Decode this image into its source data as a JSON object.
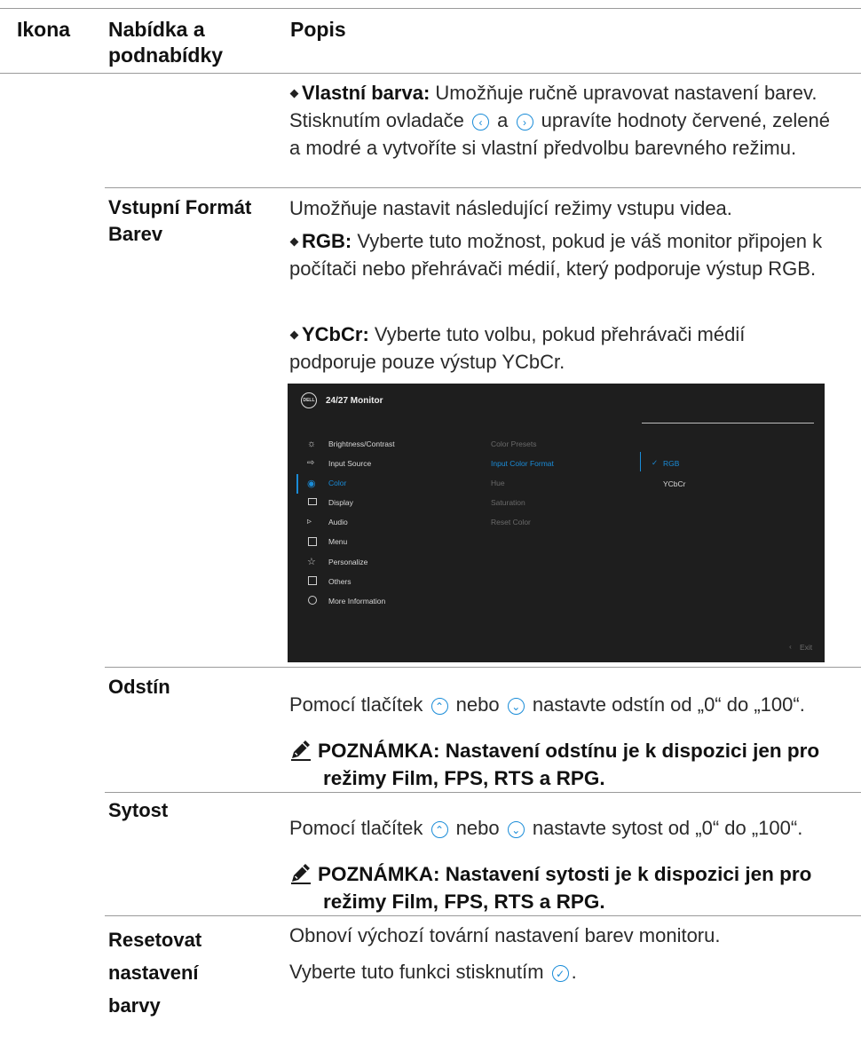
{
  "table": {
    "headers": {
      "icon": "Ikona",
      "menu": "Nabídka a podnabídky",
      "desc": "Popis"
    },
    "custom_color": {
      "bullet_label": "Vlastní barva:",
      "text_1": "Umožňuje ručně upravovat nastavení barev. Stisknutím ovladače",
      "text_2": "a",
      "text_3": "upravíte hodnoty červené, zelené a modré a vytvoříte si vlastní předvolbu barevného režimu."
    },
    "input_color_format": {
      "label": "Vstupní Formát Barev",
      "intro": "Umožňuje nastavit následující režimy vstupu videa.",
      "rgb_label": "RGB:",
      "rgb_text": "Vyberte tuto možnost, pokud je váš monitor připojen k počítači nebo přehrávači médií, který podporuje výstup RGB.",
      "ycbcr_label": "YCbCr:",
      "ycbcr_text": "Vyberte tuto volbu, pokud přehrávači médií podporuje pouze výstup YCbCr."
    },
    "hue": {
      "label": "Odstín",
      "text_1": "Pomocí tlačítek",
      "text_2": "nebo",
      "text_3": "nastavte odstín od „0“ do „100“.",
      "note": "POZNÁMKA:  Nastavení odstínu je k dispozici jen pro režimy Film, FPS, RTS a RPG."
    },
    "saturation": {
      "label": "Sytost",
      "text_1": "Pomocí tlačítek",
      "text_2": "nebo",
      "text_3": "nastavte sytost od „0“ do „100“.",
      "note": "POZNÁMKA: Nastavení sytosti je k dispozici jen pro režimy Film, FPS, RTS a RPG."
    },
    "reset_color": {
      "label": "Resetovat nastavení barvy",
      "text_1": "Obnoví výchozí tovární nastavení barev monitoru.",
      "text_2": "Vyberte tuto funkci stisknutím"
    }
  },
  "osd": {
    "logo": "DELL",
    "title": "24/27 Monitor",
    "menu": [
      "Brightness/Contrast",
      "Input Source",
      "Color",
      "Display",
      "Audio",
      "Menu",
      "Personalize",
      "Others",
      "More Information"
    ],
    "submenu": [
      "Color Presets",
      "Input Color Format",
      "Hue",
      "Saturation",
      "Reset Color"
    ],
    "options": [
      "RGB",
      "YCbCr"
    ],
    "exit": "Exit",
    "colors": {
      "background": "#1e1e1e",
      "accent": "#1a8cd8"
    }
  }
}
